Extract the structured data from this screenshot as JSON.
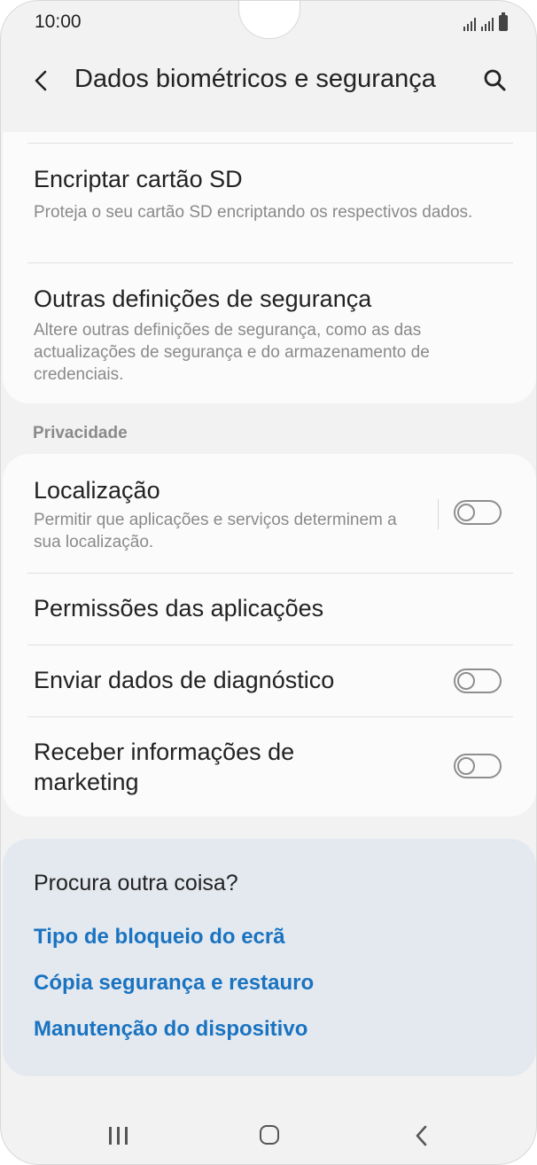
{
  "status": {
    "time": "10:00"
  },
  "header": {
    "title": "Dados biométricos e segurança",
    "back_icon": "chevron-left-icon",
    "search_icon": "search-icon"
  },
  "security": {
    "items": [
      {
        "title": "Encriptar cartão SD",
        "subtitle": "Proteja o seu cartão SD encriptando os respectivos dados."
      },
      {
        "title": "Outras definições de segurança",
        "subtitle": "Altere outras definições de segurança, como as das actualizações de segurança e do armazenamento de credenciais."
      }
    ]
  },
  "privacy": {
    "section_label": "Privacidade",
    "items": [
      {
        "title": "Localização",
        "subtitle": "Permitir que aplicações e serviços determinem a sua localização.",
        "toggle_on": false
      },
      {
        "title": "Permissões das aplicações"
      },
      {
        "title": "Enviar dados de diagnóstico",
        "toggle_on": false
      },
      {
        "title": "Receber informações de marketing",
        "toggle_on": false
      }
    ]
  },
  "suggestions": {
    "title": "Procura outra coisa?",
    "links": [
      "Tipo de bloqueio do ecrã",
      "Cópia segurança e restauro",
      "Manutenção do dispositivo"
    ]
  },
  "colors": {
    "background": "#f2f2f2",
    "card": "#fbfbfb",
    "suggest_bg": "#e4e9f0",
    "link": "#1a73c0",
    "subtitle": "#8a8a8a"
  }
}
